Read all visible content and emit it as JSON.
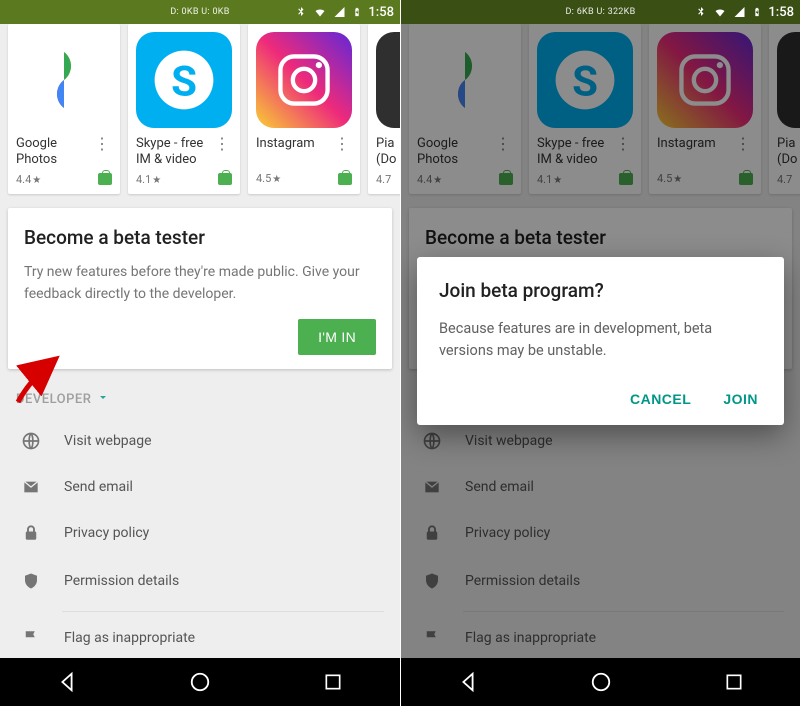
{
  "statusbar": {
    "net_left": "D: 0KB    U: 0KB",
    "net_right": "D: 6KB    U: 322KB",
    "time": "1:58"
  },
  "apps": [
    {
      "name": "Google Photos",
      "rating": "4.4"
    },
    {
      "name": "Skype - free IM & video",
      "rating": "4.1"
    },
    {
      "name": "Instagram",
      "rating": "4.5"
    },
    {
      "name_partial": "Pia",
      "name_partial2": "(Do",
      "rating": "4.7"
    }
  ],
  "beta": {
    "title": "Become a beta tester",
    "text": "Try new features before they're made public. Give your feedback directly to the developer.",
    "button": "I'M IN"
  },
  "developer": {
    "header": "DEVELOPER",
    "items": [
      "Visit webpage",
      "Send email",
      "Privacy policy",
      "Permission details",
      "Flag as inappropriate"
    ]
  },
  "dialog": {
    "title": "Join beta program?",
    "text": "Because features are in development, beta versions may be unstable.",
    "cancel": "CANCEL",
    "join": "JOIN"
  }
}
